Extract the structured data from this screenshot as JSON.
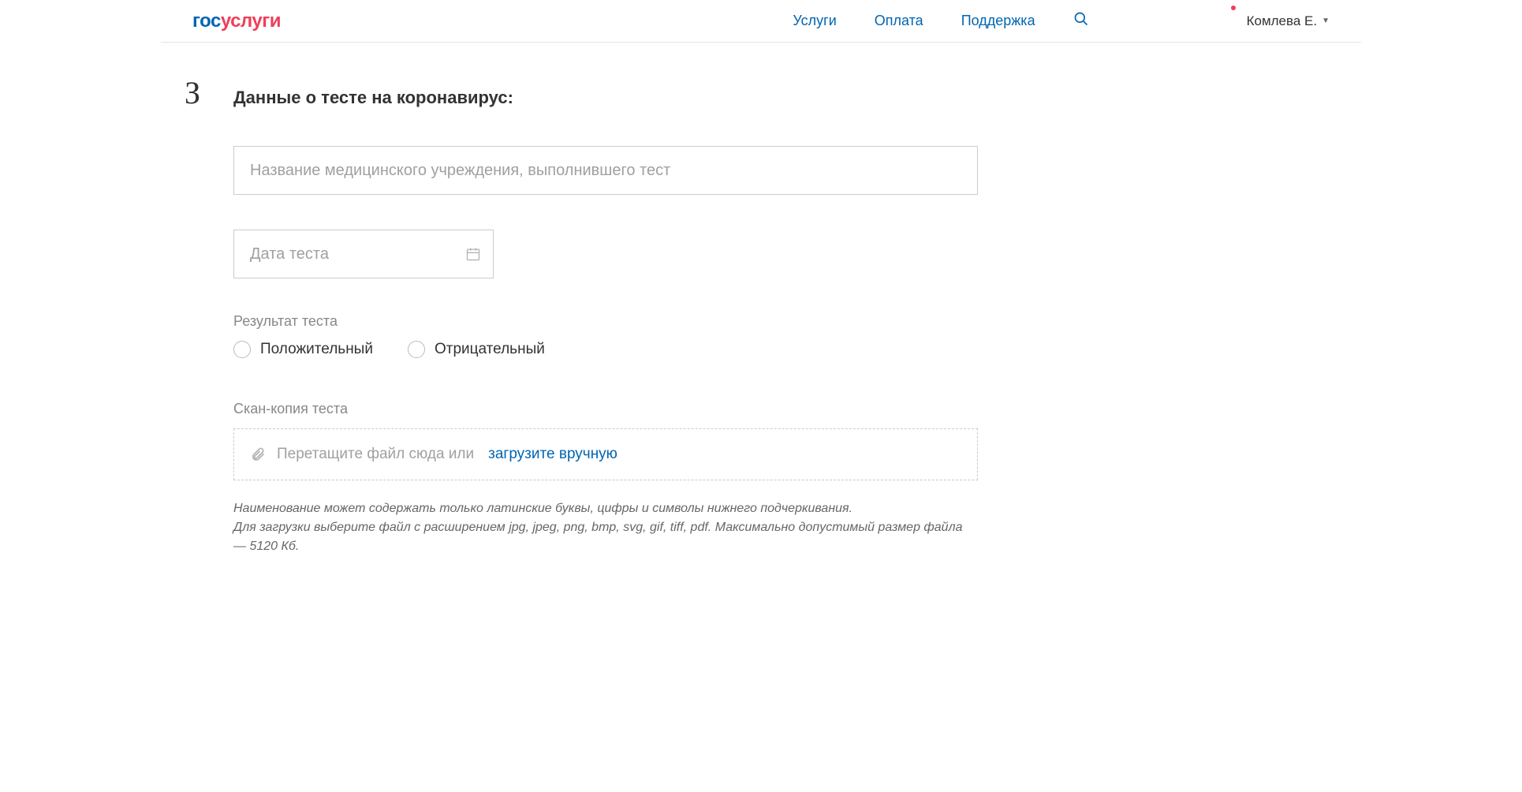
{
  "header": {
    "logo_gos": "гос",
    "logo_uslugi": "услуги",
    "nav": {
      "services": "Услуги",
      "payment": "Оплата",
      "support": "Поддержка"
    },
    "user_name": "Комлева Е."
  },
  "step": {
    "number": "3",
    "title": "Данные о тесте на коронавирус:"
  },
  "form": {
    "institution_placeholder": "Название медицинского учреждения, выполнившего тест",
    "date_placeholder": "Дата теста",
    "result_label": "Результат теста",
    "result_positive": "Положительный",
    "result_negative": "Отрицательный",
    "scan_label": "Скан-копия теста",
    "upload_text": "Перетащите файл сюда или",
    "upload_link": "загрузите вручную",
    "hint_line1": "Наименование может содержать только латинские буквы, цифры и символы нижнего подчеркивания.",
    "hint_line2": "Для загрузки выберите файл с расширением jpg, jpeg, png, bmp, svg, gif, tiff, pdf. Максимально допустимый размер файла — 5120 Кб."
  }
}
